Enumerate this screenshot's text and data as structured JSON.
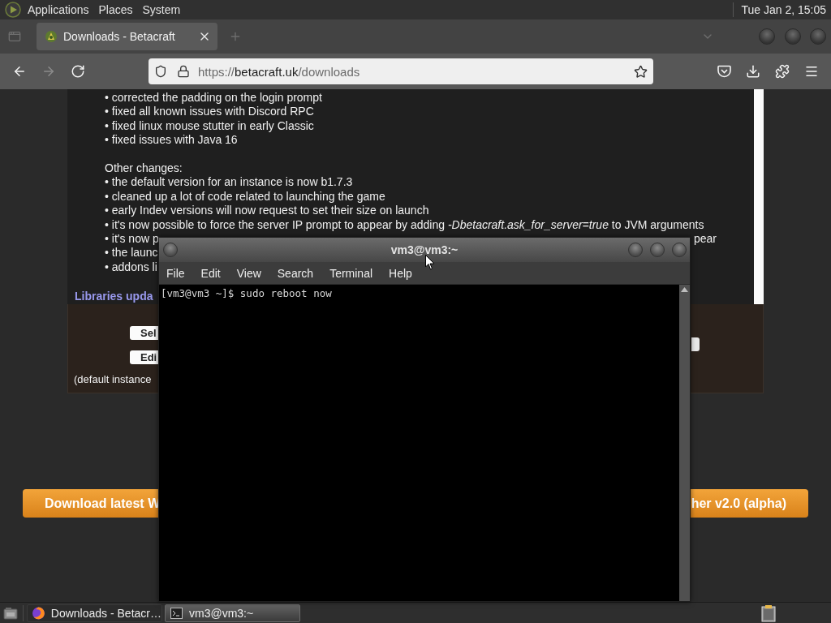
{
  "top_panel": {
    "menus": [
      "Applications",
      "Places",
      "System"
    ],
    "clock": "Tue Jan 2, 15:05"
  },
  "browser": {
    "tabs": [
      {
        "title": "Downloads - Betacraft",
        "selected": true
      }
    ],
    "nav_buttons": [
      {
        "kind": "back",
        "disabled": false
      },
      {
        "kind": "forward",
        "disabled": true
      },
      {
        "kind": "reload",
        "disabled": false
      }
    ],
    "url": {
      "scheme": "https://",
      "domain": "betacraft.uk",
      "path": "/downloads"
    },
    "page": {
      "changelog": [
        {
          "kind": "item",
          "text": "• corrected the padding on the login prompt"
        },
        {
          "kind": "item",
          "text": "• fixed all known issues with Discord RPC"
        },
        {
          "kind": "item",
          "text": "• fixed linux mouse stutter in early Classic"
        },
        {
          "kind": "item",
          "text": "• fixed issues with Java 16"
        },
        {
          "kind": "heading",
          "text": "Other changes:"
        },
        {
          "kind": "item",
          "text": "• the default version for an instance is now b1.7.3"
        },
        {
          "kind": "item",
          "text": "• cleaned up a lot of code related to launching the game"
        },
        {
          "kind": "item",
          "text": "• early Indev versions will now request to set their size on launch"
        },
        {
          "kind": "item",
          "text": "• it's now possible to force the server IP prompt to appear by adding *-Dbetacraft.ask_for_server=true* to JVM arguments"
        },
        {
          "kind": "item",
          "text": "• it's now p",
          "tail": "pear"
        },
        {
          "kind": "item",
          "text": "• the launc"
        },
        {
          "kind": "item",
          "text": "• addons li"
        }
      ],
      "section_heading": "Libraries upda",
      "instance_buttons": [
        "Sel",
        "Edi"
      ],
      "instance_note": "(default instance",
      "download_buttons": [
        "Download latest W",
        "her v2.0 (alpha)"
      ]
    }
  },
  "terminal": {
    "title": "vm3@vm3:~",
    "menus": [
      "File",
      "Edit",
      "View",
      "Search",
      "Terminal",
      "Help"
    ],
    "lines": [
      "[vm3@vm3 ~]$ sudo reboot now"
    ]
  },
  "taskbar": {
    "tasks": [
      {
        "kind": "browser",
        "title": "Downloads - Betacr…",
        "selected": false
      },
      {
        "kind": "terminal",
        "title": "vm3@vm3:~",
        "selected": true
      }
    ]
  }
}
